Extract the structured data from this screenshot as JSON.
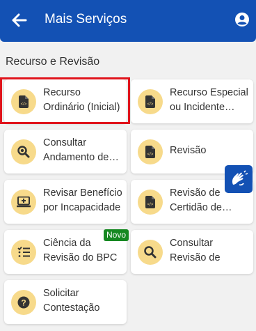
{
  "header": {
    "title": "Mais Serviços"
  },
  "section": {
    "title": "Recurso e Revisão"
  },
  "cards": [
    {
      "label": "Recurso Ordinário (Inicial)",
      "icon": "file-code-icon"
    },
    {
      "label": "Recurso Especial ou Incidente…",
      "icon": "file-code-icon"
    },
    {
      "label": "Consultar Andamento de…",
      "icon": "magnify-icon"
    },
    {
      "label": "Revisão",
      "icon": "file-code-icon"
    },
    {
      "label": "Revisar Benefício por Incapacidade",
      "icon": "laptop-plus-icon"
    },
    {
      "label": "Revisão de Certidão de…",
      "icon": "file-code-icon"
    },
    {
      "label": "Ciência da Revisão do BPC",
      "icon": "checklist-icon"
    },
    {
      "label": "Consultar Revisão de Benefício -…",
      "icon": "magnify-icon"
    },
    {
      "label": "Solicitar Contestação de…",
      "icon": "question-circle-icon"
    }
  ],
  "badge": {
    "label": "Novo"
  },
  "colors": {
    "primary": "#1351b4",
    "icon_bg": "#f7da8b",
    "icon_fg": "#333333",
    "highlight": "#e0141c",
    "badge": "#168821"
  }
}
